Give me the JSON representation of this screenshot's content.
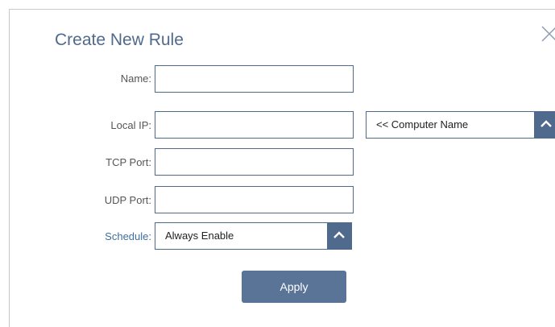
{
  "dialog": {
    "title": "Create New Rule",
    "close_icon": "close-icon"
  },
  "form": {
    "name_label": "Name:",
    "name_value": "",
    "local_ip_label": "Local IP:",
    "local_ip_value": "",
    "computer_name_select": "<< Computer Name",
    "tcp_port_label": "TCP Port:",
    "tcp_port_value": "",
    "udp_port_label": "UDP Port:",
    "udp_port_value": "",
    "schedule_label": "Schedule:",
    "schedule_value": "Always Enable",
    "apply_label": "Apply"
  },
  "colors": {
    "accent": "#4f6a8c",
    "button": "#5a7498",
    "schedule_label": "#3f6f9f"
  }
}
